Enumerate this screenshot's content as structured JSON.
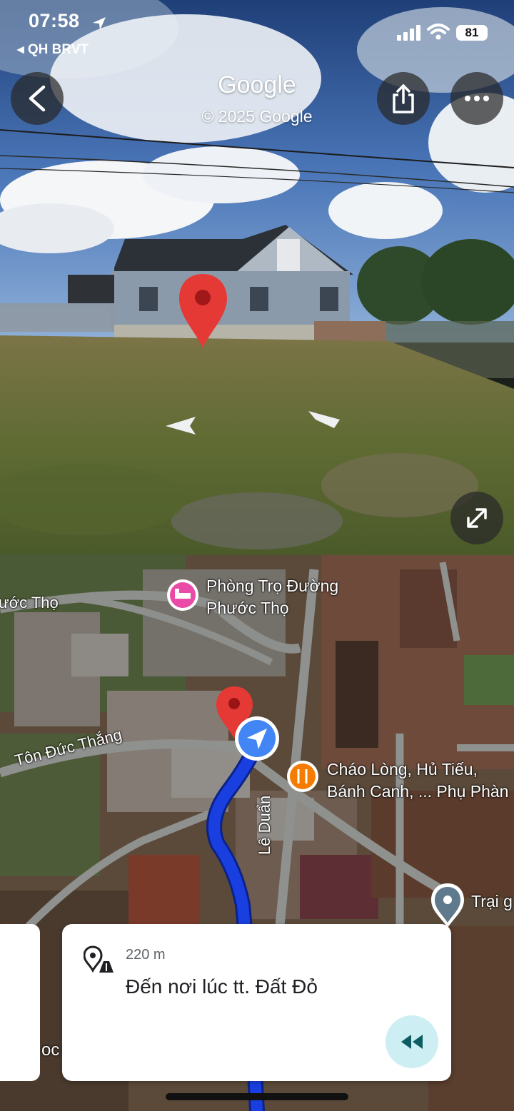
{
  "status_bar": {
    "time": "07:58",
    "back_app": "◂ QH BRVT",
    "battery": "81"
  },
  "street_view": {
    "title": "Google",
    "copyright": "© 2025 Google",
    "icons": [
      "back-arrow-icon",
      "share-icon",
      "more-icon",
      "expand-icon",
      "location-pin-icon",
      "nav-arrow-left-icon",
      "nav-arrow-right-icon"
    ]
  },
  "map": {
    "street_labels": {
      "phuoc_tho": "ước Thọ",
      "ton_duc_thang": "Tôn Đức Thắng",
      "le_duan": "Lê Duẩn"
    },
    "pois": {
      "lodging_line1": "Phòng Trọ Đường",
      "lodging_line2": "Phước Thọ",
      "food_line1": "Cháo Lòng, Hủ Tiếu,",
      "food_line2": "Bánh Canh, ... Phụ Phàn",
      "place": "Trại g"
    },
    "fragment_text": "oc",
    "route_color": "#1a3fe0"
  },
  "nav_card": {
    "distance": "220 m",
    "instruction": "Đến nơi lúc tt. Đất Đỏ"
  },
  "colors": {
    "pin_red": "#e53935",
    "location_blue": "#4285f4",
    "lodging_pink": "#e94ba6",
    "food_orange": "#f57c00",
    "rewind_bg": "#cdeef3"
  }
}
